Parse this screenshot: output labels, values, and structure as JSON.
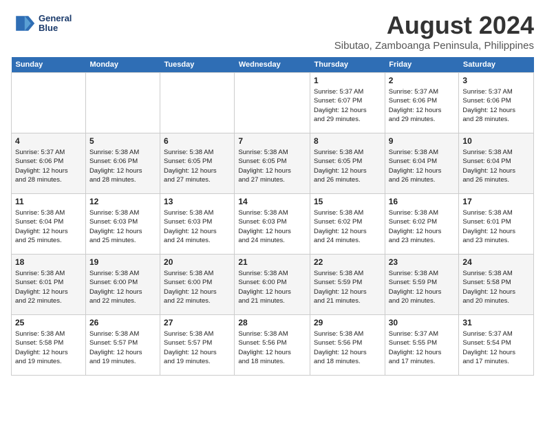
{
  "logo": {
    "line1": "General",
    "line2": "Blue"
  },
  "title": "August 2024",
  "subtitle": "Sibutao, Zamboanga Peninsula, Philippines",
  "days_of_week": [
    "Sunday",
    "Monday",
    "Tuesday",
    "Wednesday",
    "Thursday",
    "Friday",
    "Saturday"
  ],
  "weeks": [
    [
      {
        "day": "",
        "info": ""
      },
      {
        "day": "",
        "info": ""
      },
      {
        "day": "",
        "info": ""
      },
      {
        "day": "",
        "info": ""
      },
      {
        "day": "1",
        "info": "Sunrise: 5:37 AM\nSunset: 6:07 PM\nDaylight: 12 hours\nand 29 minutes."
      },
      {
        "day": "2",
        "info": "Sunrise: 5:37 AM\nSunset: 6:06 PM\nDaylight: 12 hours\nand 29 minutes."
      },
      {
        "day": "3",
        "info": "Sunrise: 5:37 AM\nSunset: 6:06 PM\nDaylight: 12 hours\nand 28 minutes."
      }
    ],
    [
      {
        "day": "4",
        "info": "Sunrise: 5:37 AM\nSunset: 6:06 PM\nDaylight: 12 hours\nand 28 minutes."
      },
      {
        "day": "5",
        "info": "Sunrise: 5:38 AM\nSunset: 6:06 PM\nDaylight: 12 hours\nand 28 minutes."
      },
      {
        "day": "6",
        "info": "Sunrise: 5:38 AM\nSunset: 6:05 PM\nDaylight: 12 hours\nand 27 minutes."
      },
      {
        "day": "7",
        "info": "Sunrise: 5:38 AM\nSunset: 6:05 PM\nDaylight: 12 hours\nand 27 minutes."
      },
      {
        "day": "8",
        "info": "Sunrise: 5:38 AM\nSunset: 6:05 PM\nDaylight: 12 hours\nand 26 minutes."
      },
      {
        "day": "9",
        "info": "Sunrise: 5:38 AM\nSunset: 6:04 PM\nDaylight: 12 hours\nand 26 minutes."
      },
      {
        "day": "10",
        "info": "Sunrise: 5:38 AM\nSunset: 6:04 PM\nDaylight: 12 hours\nand 26 minutes."
      }
    ],
    [
      {
        "day": "11",
        "info": "Sunrise: 5:38 AM\nSunset: 6:04 PM\nDaylight: 12 hours\nand 25 minutes."
      },
      {
        "day": "12",
        "info": "Sunrise: 5:38 AM\nSunset: 6:03 PM\nDaylight: 12 hours\nand 25 minutes."
      },
      {
        "day": "13",
        "info": "Sunrise: 5:38 AM\nSunset: 6:03 PM\nDaylight: 12 hours\nand 24 minutes."
      },
      {
        "day": "14",
        "info": "Sunrise: 5:38 AM\nSunset: 6:03 PM\nDaylight: 12 hours\nand 24 minutes."
      },
      {
        "day": "15",
        "info": "Sunrise: 5:38 AM\nSunset: 6:02 PM\nDaylight: 12 hours\nand 24 minutes."
      },
      {
        "day": "16",
        "info": "Sunrise: 5:38 AM\nSunset: 6:02 PM\nDaylight: 12 hours\nand 23 minutes."
      },
      {
        "day": "17",
        "info": "Sunrise: 5:38 AM\nSunset: 6:01 PM\nDaylight: 12 hours\nand 23 minutes."
      }
    ],
    [
      {
        "day": "18",
        "info": "Sunrise: 5:38 AM\nSunset: 6:01 PM\nDaylight: 12 hours\nand 22 minutes."
      },
      {
        "day": "19",
        "info": "Sunrise: 5:38 AM\nSunset: 6:00 PM\nDaylight: 12 hours\nand 22 minutes."
      },
      {
        "day": "20",
        "info": "Sunrise: 5:38 AM\nSunset: 6:00 PM\nDaylight: 12 hours\nand 22 minutes."
      },
      {
        "day": "21",
        "info": "Sunrise: 5:38 AM\nSunset: 6:00 PM\nDaylight: 12 hours\nand 21 minutes."
      },
      {
        "day": "22",
        "info": "Sunrise: 5:38 AM\nSunset: 5:59 PM\nDaylight: 12 hours\nand 21 minutes."
      },
      {
        "day": "23",
        "info": "Sunrise: 5:38 AM\nSunset: 5:59 PM\nDaylight: 12 hours\nand 20 minutes."
      },
      {
        "day": "24",
        "info": "Sunrise: 5:38 AM\nSunset: 5:58 PM\nDaylight: 12 hours\nand 20 minutes."
      }
    ],
    [
      {
        "day": "25",
        "info": "Sunrise: 5:38 AM\nSunset: 5:58 PM\nDaylight: 12 hours\nand 19 minutes."
      },
      {
        "day": "26",
        "info": "Sunrise: 5:38 AM\nSunset: 5:57 PM\nDaylight: 12 hours\nand 19 minutes."
      },
      {
        "day": "27",
        "info": "Sunrise: 5:38 AM\nSunset: 5:57 PM\nDaylight: 12 hours\nand 19 minutes."
      },
      {
        "day": "28",
        "info": "Sunrise: 5:38 AM\nSunset: 5:56 PM\nDaylight: 12 hours\nand 18 minutes."
      },
      {
        "day": "29",
        "info": "Sunrise: 5:38 AM\nSunset: 5:56 PM\nDaylight: 12 hours\nand 18 minutes."
      },
      {
        "day": "30",
        "info": "Sunrise: 5:37 AM\nSunset: 5:55 PM\nDaylight: 12 hours\nand 17 minutes."
      },
      {
        "day": "31",
        "info": "Sunrise: 5:37 AM\nSunset: 5:54 PM\nDaylight: 12 hours\nand 17 minutes."
      }
    ]
  ]
}
